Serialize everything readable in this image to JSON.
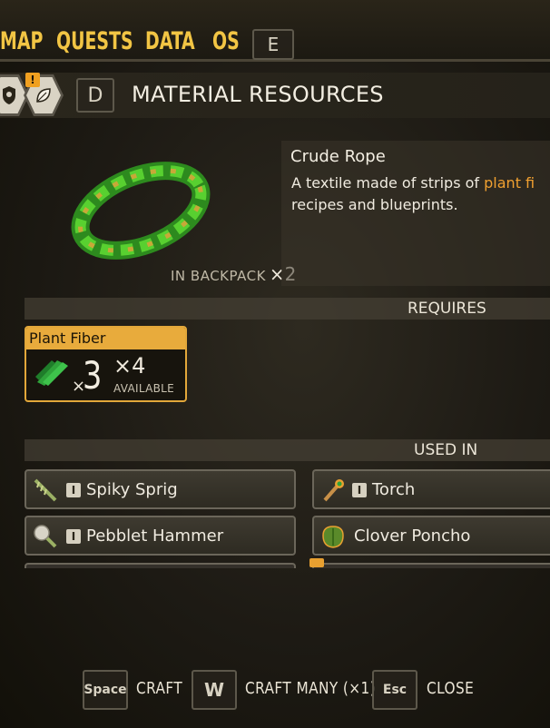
{
  "nav": {
    "tabs": [
      {
        "label": "MAP"
      },
      {
        "label": "QUESTS"
      },
      {
        "label": "DATA"
      },
      {
        "label": "OS"
      }
    ],
    "next_key": "E",
    "accent_color": "#f2c544"
  },
  "header": {
    "prev_key": "D",
    "title": "MATERIAL RESOURCES",
    "alert_badge": "!",
    "icons": [
      "shield-icon",
      "leaf-icon"
    ]
  },
  "item": {
    "name": "Crude Rope",
    "description_part1": "A textile made of strips of ",
    "description_highlight": "plant fi",
    "description_part2": "recipes and blueprints.",
    "in_backpack_label": "IN BACKPACK",
    "in_backpack_count": "×2",
    "icon": "crude-rope-icon"
  },
  "requires": {
    "label": "REQUIRES",
    "ingredients": [
      {
        "name": "Plant Fiber",
        "times": "×",
        "qty": "3",
        "have": "×4",
        "available_label": "AVAILABLE",
        "icon": "plant-fiber-icon"
      }
    ]
  },
  "used_in": {
    "label": "USED IN",
    "items": [
      {
        "label": "Spiky Sprig",
        "tier": "I",
        "icon": "spiky-sprig-icon"
      },
      {
        "label": "Torch",
        "tier": "I",
        "icon": "torch-icon"
      },
      {
        "label": "Pebblet Hammer",
        "tier": "I",
        "icon": "pebblet-hammer-icon"
      },
      {
        "label": "Clover Poncho",
        "tier": "",
        "icon": "clover-poncho-icon"
      }
    ]
  },
  "footer": {
    "actions": [
      {
        "key": "Space",
        "label": "CRAFT"
      },
      {
        "key": "W",
        "label": "CRAFT MANY (×1)"
      },
      {
        "key": "Esc",
        "label": "CLOSE"
      }
    ]
  }
}
